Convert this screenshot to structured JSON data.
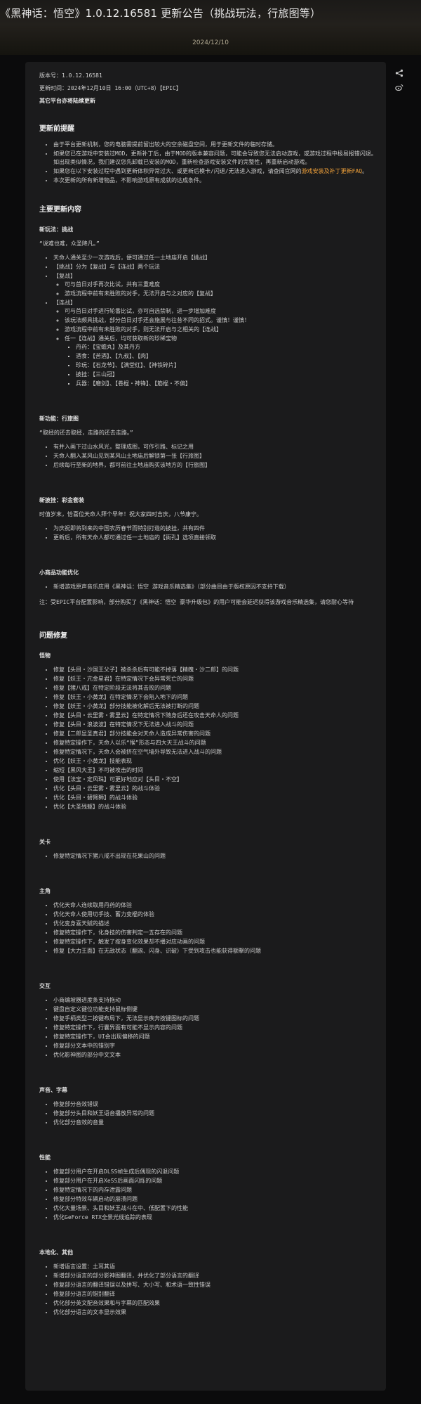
{
  "header": {
    "title": "《黑神话：悟空》1.0.12.16581 更新公告（挑战玩法，行旅图等）",
    "date": "2024/12/10"
  },
  "icons": {
    "share": "share-icon",
    "weibo": "weibo-icon"
  },
  "meta": {
    "version": "版本号：1.0.12.16581",
    "update_time": "更新时间：2024年12月10日 16:00（UTC+8）【EPIC】",
    "other_platforms": "其它平台亦将陆续更新"
  },
  "pre_notice": {
    "heading": "更新前提醒",
    "items": [
      {
        "text": "由于平台更新机制，您的电脑需提前留出较大的空余磁盘空间，用于更新文件的临时存储。"
      },
      {
        "text": "如果您已在游戏中安装过MOD，更新补丁后，由于MOD的版本兼容问题，可能会导致您无法启动游戏，或游戏过程中极易报错闪退。如出现类似情况，我们建议您先卸载已安装的MOD，重新检查游戏安装文件的完整性，再重新启动游戏。"
      },
      {
        "text_before": "如果您在以下安装过程中遇到更新体积异常过大、或更新后模卡/闪退/无法进入游戏，请查阅官网的",
        "link": "游戏安装及补丁更新FAQ",
        "text_after": "。"
      },
      {
        "text": "本次更新的所有新增物品，不影响游戏原有成就的达成条件。"
      }
    ]
  },
  "main": {
    "heading": "主要更新内容",
    "challenge": {
      "heading": "新玩法：挑战",
      "quote": "“说难也难，众圣降凡。”",
      "items": [
        "天命人通关至少一次游戏后，便可通过任一土地庙开启【挑战】",
        "【挑战】分为【复战】与【连战】两个玩法",
        "【复战】",
        "可与首日对手再次比试，共有三重难度",
        "游戏流程中前有未胜败的对手，无法开启与之对应的【复战】",
        "【连战】",
        "可与首日对手进行轮番比试，亦可自选禁制，进一步增加难度",
        "该玩法颇具挑战，部分首日对手还会施展与往昔不同的招式。谨慎！谨慎！",
        "游戏流程中前有未胜败的对手，则无法开启与之相关的【连战】",
        "任一【连战】通关后，均可获取新的珍稀宝物",
        "丹药：【宝蟾丸】及其丹方",
        "酒食：【苦酒】、【九叔】、【肉】",
        "珍玩：【石龙节】、【满堂红】、【神铁碎片】",
        "披挂：【三山冠】",
        "兵器：【磨剑】、【卷棍・神锋】、【筋棍・不偏】"
      ]
    },
    "travelmap": {
      "heading": "新功能：行旅图",
      "quote": "“取经的还去取经，走路的还去走路。”",
      "items": [
        "有并入画下过山水风光，整理成图，可作引路、标记之用",
        "天命人翻入某风山见到某风山土地庙后解锁第一张【行旅图】",
        "后续每行至新的地界，都可前往土地庙购买该地方的【行旅图】"
      ]
    },
    "skin": {
      "heading": "新披挂：彩金套装",
      "para": "时值岁末，恰喜位天命人拜个早年！祝大家四时吉庆，八节康宁。",
      "items": [
        "为庆祝即将到来的中国农历春节而特别打造的披挂，共有四件",
        "更新后，所有天命人都可通过任一土地庙的【衙孔】选项直接领取"
      ]
    },
    "mini": {
      "heading": "小商品功能优化",
      "items": [
        "新增游戏原声音乐应用《黑神话：悟空 游戏音乐精选集》（部分曲目由于版权原因不支持下载）"
      ],
      "note": "注：受EPIC平台配置影响，部分购买了《黑神话：悟空 豪华升级包》的用户可能会延迟获得该游戏音乐精选集，请您耐心等待"
    }
  },
  "fixes": {
    "heading": "问题修复",
    "monsters": {
      "heading": "怪物",
      "items": [
        "修复【头目・沙国王父子】被杀杀后有可能不掉落【精魄・沙二郎】的问题",
        "修复【妖王・亢金星君】在特定情况下会异常死亡的问题",
        "修复【猪八戒】在特定阶段无法将其击败的问题",
        "修复【妖王・小黄龙】在特定情况下会陷入地下的问题",
        "修复【妖王・小黄龙】部分技能被化解后无法被打断的问题",
        "修复【头目・云里雾・雾里云】在特定情况下随身后还在攻击天命人的问题",
        "修复【头目・浪波波】在特定情况下无法进入战斗的问题",
        "修复【二郎显圣真君】部分技能会对天命人造成异常伤害的问题",
        "修复特定操作下，天命人以乐“猴”形态与四大天王战斗的问题",
        "修复特定情况下，天命人会被挤在空气墙外导致无法进入战斗的问题",
        "优化【妖王・小黄龙】技能表现",
        "缩短【黑风大王】不可被攻击的时间",
        "使用【法宝・定风珠】可更好地应对【头目・不空】",
        "优化【头目・云里雾・雾里云】的战斗体验",
        "优化【头目・碧臂狮】的战斗体验",
        "优化【大圣残躯】的战斗体验"
      ]
    },
    "levels": {
      "heading": "关卡",
      "items": [
        "修复特定情况下猪八戒不出现在花果山的问题"
      ]
    },
    "protagonist": {
      "heading": "主角",
      "items": [
        "优化天命人连续取用丹药的体验",
        "优化天命人使用切手技、蓄力变棍的体验",
        "优化变身喜天赋的描述",
        "修复特定操作下，化身技的伤害判定一五存在的问题",
        "修复特定操作下，触发了按身变化效果却不播对应动画的问题",
        "修复【大力王面】在无敌状态（翻滚、闪身、识破）下受到攻击也能获得额擊的问题"
      ]
    },
    "interaction": {
      "heading": "交互",
      "items": [
        "小商编坡器进度条支持拖动",
        "键盘自定义键位功能支持鼠标侧键",
        "修复手柄类型二按键布局下，无法显示疾奔按键图标的问题",
        "修复特定操作下，行囊界面有可能不显示内容的问题",
        "修复特定操作下，UI会出现偏移的问题",
        "修复部分文本中的错别字",
        "优化影神图的部分中文文本"
      ]
    },
    "audio": {
      "heading": "声音、字幕",
      "items": [
        "修复部分音效错误",
        "修复部分头目和妖王语音播放异常的问题",
        "优化部分音效的音量"
      ]
    },
    "performance": {
      "heading": "性能",
      "items": [
        "修复部分用户在开启DLSS帧生成后偶现的闪退问题",
        "修复部分用户在开启XeSS后画面闪烁的问题",
        "修复特定情况下的内存泄露问题",
        "修复部分特效车辆启动的崩溃问题",
        "优化大量场景、头目和妖王战斗在中、低配置下的性能",
        "优化GeForce RTX全景光线追踪的表现"
      ]
    },
    "localization": {
      "heading": "本地化、其他",
      "items": [
        "新增语言设置：土耳其语",
        "新增部分语言的部分影神图翻译，并优化了部分语言的翻译",
        "修复部分语言的翻译错误以及拼写、大小写、和术语一致性错误",
        "修复部分语言的错别翻译",
        "优化部分英文配音效果和与字幕的匹配效果",
        "优化部分语言的文本显示效果"
      ]
    }
  }
}
